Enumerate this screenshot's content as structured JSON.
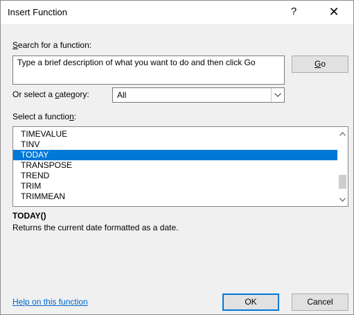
{
  "window": {
    "title": "Insert Function",
    "help_glyph": "?",
    "close_glyph": "✕"
  },
  "search": {
    "label_prefix": "",
    "label_accel": "S",
    "label_rest": "earch for a function:",
    "text": "Type a brief description of what you want to do and then click Go",
    "go_accel": "G",
    "go_rest": "o"
  },
  "category": {
    "label_before": "Or select a ",
    "label_accel": "c",
    "label_after": "ategory:",
    "selected": "All"
  },
  "function_list": {
    "label_before": "Select a functio",
    "label_accel": "n",
    "label_after": ":",
    "items": [
      "TIMEVALUE",
      "TINV",
      "TODAY",
      "TRANSPOSE",
      "TREND",
      "TRIM",
      "TRIMMEAN"
    ],
    "selected_index": 2,
    "scroll_position": 0.9
  },
  "details": {
    "signature": "TODAY()",
    "description": "Returns the current date formatted as a date."
  },
  "footer": {
    "help_link": "Help on this function",
    "ok_label": "OK",
    "cancel_label": "Cancel"
  },
  "colors": {
    "accent": "#0078d7",
    "link": "#0066cc",
    "dialog_bg": "#f0f0f0"
  }
}
